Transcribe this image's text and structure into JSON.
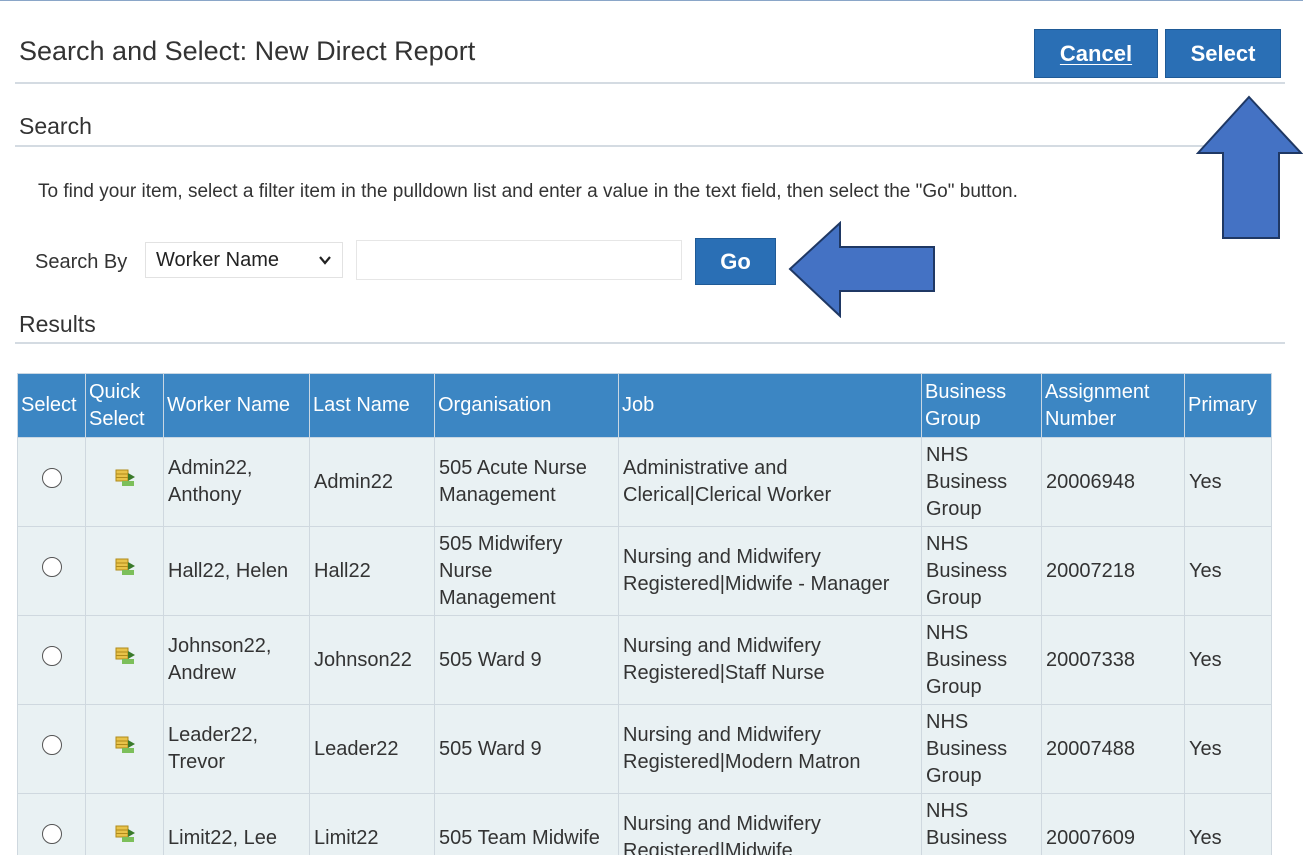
{
  "header": {
    "title": "Search and Select: New Direct Report",
    "cancel_label": "Cancel",
    "select_label": "Select"
  },
  "search": {
    "heading": "Search",
    "instructions": "To find your item, select a filter item in the pulldown list and enter a value in the text field, then select the \"Go\" button.",
    "search_by_label": "Search By",
    "filter_value": "Worker Name",
    "text_value": "",
    "go_label": "Go"
  },
  "results": {
    "heading": "Results",
    "columns": [
      "Select",
      "Quick Select",
      "Worker Name",
      "Last Name",
      "Organisation",
      "Job",
      "Business Group",
      "Assignment Number",
      "Primary"
    ],
    "rows": [
      {
        "worker": "Admin22, Anthony",
        "last": "Admin22",
        "org": "505 Acute Nurse Management",
        "job": "Administrative and Clerical|Clerical Worker",
        "group": "NHS Business Group",
        "assignment": "20006948",
        "primary": "Yes"
      },
      {
        "worker": "Hall22, Helen",
        "last": "Hall22",
        "org": "505 Midwifery Nurse Management",
        "job": "Nursing and Midwifery Registered|Midwife - Manager",
        "group": "NHS Business Group",
        "assignment": "20007218",
        "primary": "Yes"
      },
      {
        "worker": "Johnson22, Andrew",
        "last": "Johnson22",
        "org": "505 Ward 9",
        "job": "Nursing and Midwifery Registered|Staff Nurse",
        "group": "NHS Business Group",
        "assignment": "20007338",
        "primary": "Yes"
      },
      {
        "worker": "Leader22, Trevor",
        "last": "Leader22",
        "org": "505 Ward 9",
        "job": "Nursing and Midwifery Registered|Modern Matron",
        "group": "NHS Business Group",
        "assignment": "20007488",
        "primary": "Yes"
      },
      {
        "worker": "Limit22, Lee",
        "last": "Limit22",
        "org": "505 Team Midwife",
        "job": "Nursing and Midwifery Registered|Midwife",
        "group": "NHS Business Group",
        "assignment": "20007609",
        "primary": "Yes"
      }
    ]
  },
  "colors": {
    "accent": "#2a6fb5",
    "table_header": "#3c86c3",
    "row_bg": "#e9f1f3",
    "arrow": "#4472c4"
  },
  "icons": {
    "quick_select": "quick-select-icon",
    "radio": "radio-button",
    "dropdown": "chevron-down-icon",
    "annotation_arrows": "arrow-up-icon / arrow-left-icon"
  }
}
